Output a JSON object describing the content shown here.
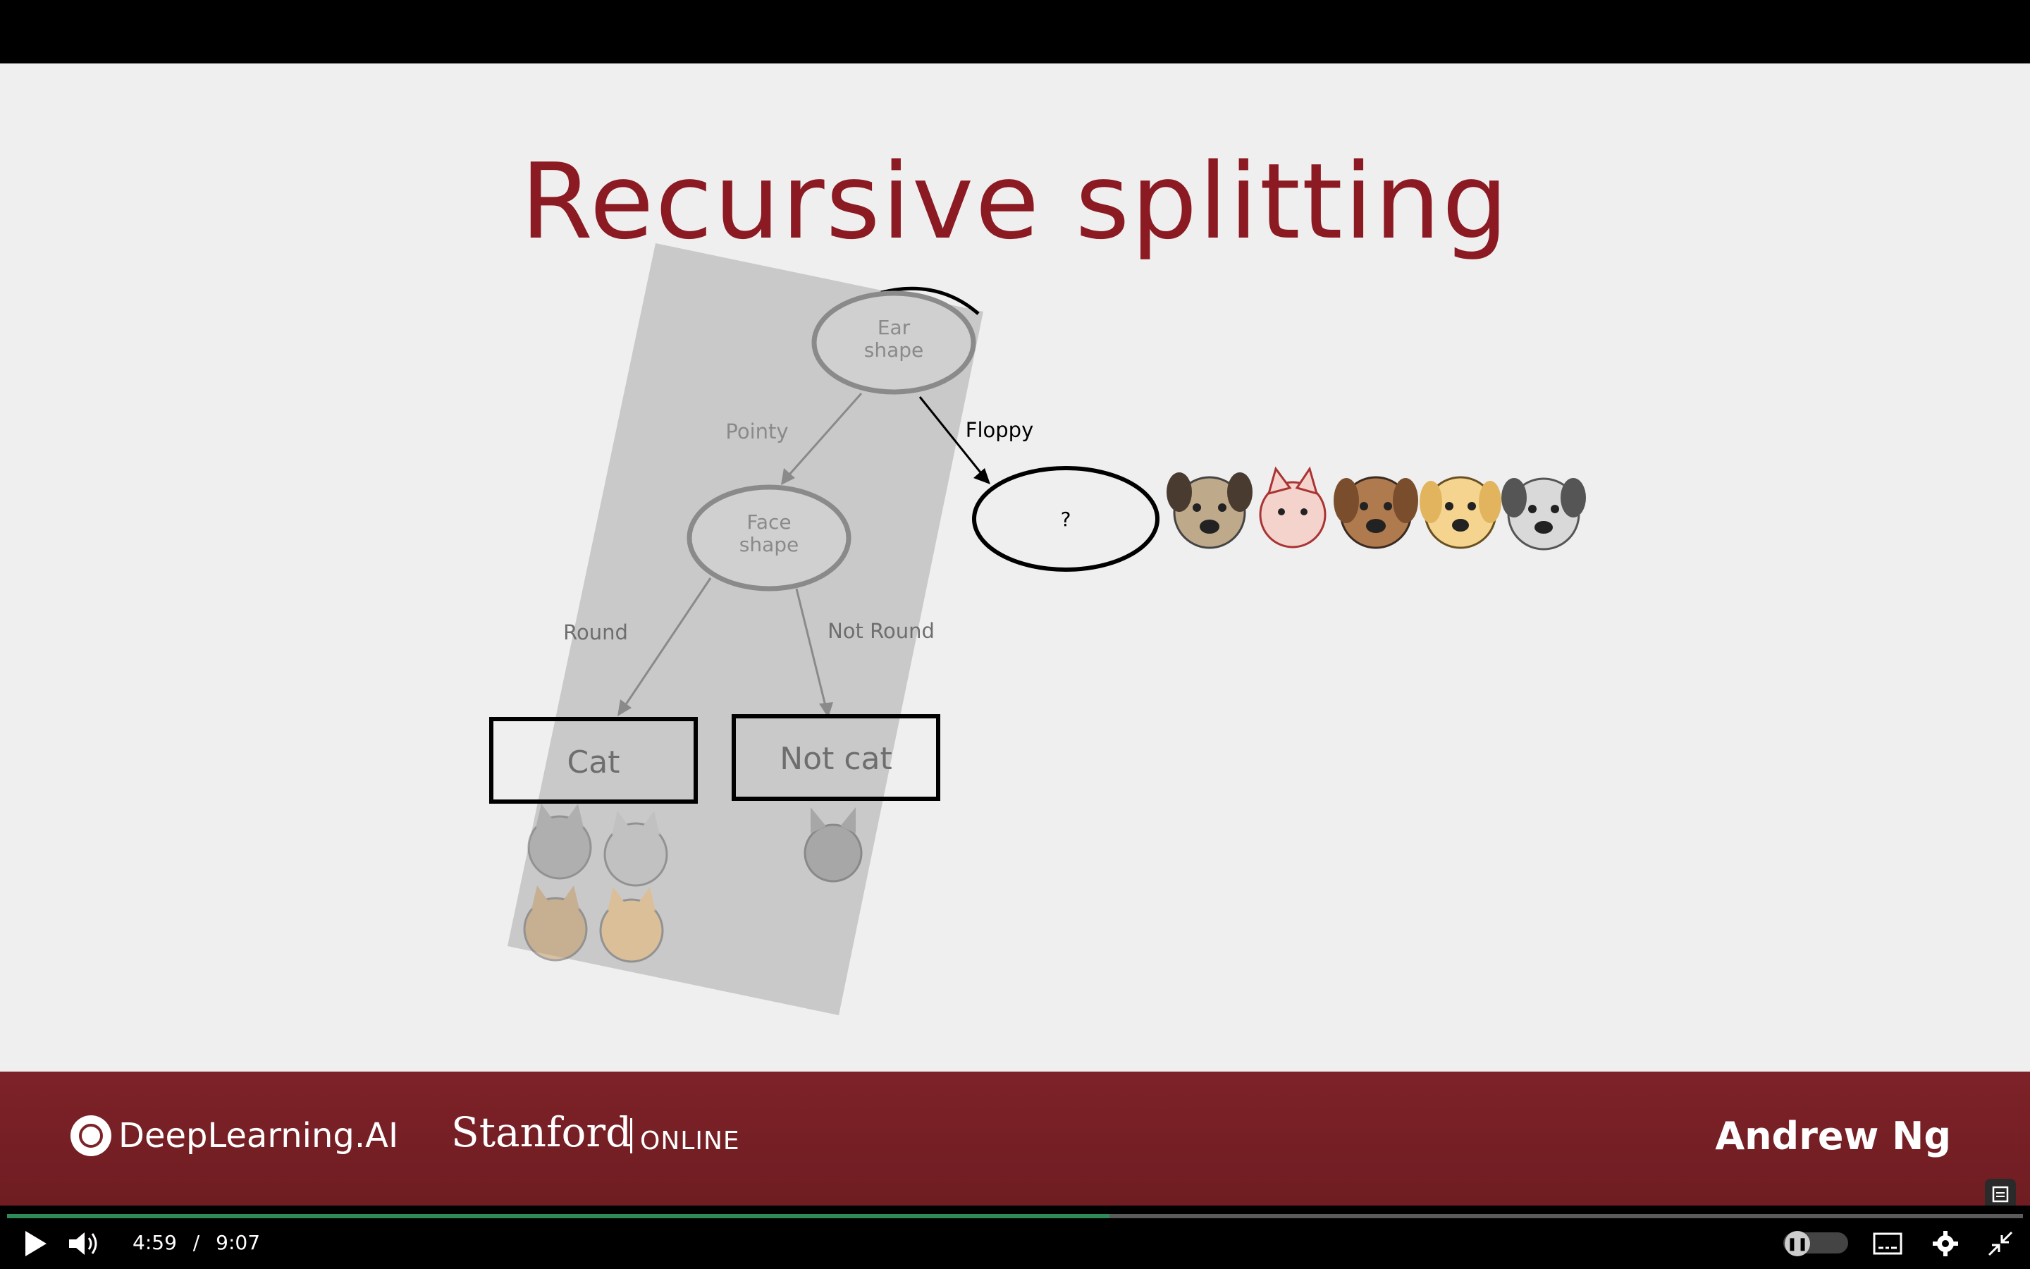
{
  "slide": {
    "title": "Recursive splitting",
    "nodes": {
      "root": "Ear shape",
      "face": "Face shape",
      "question": "?",
      "cat_leaf": "Cat",
      "notcat_leaf": "Not cat"
    },
    "edges": {
      "pointy": "Pointy",
      "floppy": "Floppy",
      "round": "Round",
      "not_round": "Not Round"
    }
  },
  "footer": {
    "deeplearning": "DeepLearning.AI",
    "stanford": "Stanford",
    "online": "ONLINE",
    "author": "Andrew Ng"
  },
  "player": {
    "current_time": "4:59",
    "separator": "/",
    "duration": "9:07",
    "progress": 0.547,
    "accent": "#2e8b57",
    "icons": [
      "play-icon",
      "volume-icon",
      "pip-toggle",
      "captions-icon",
      "settings-icon",
      "exit-fullscreen-icon"
    ]
  }
}
